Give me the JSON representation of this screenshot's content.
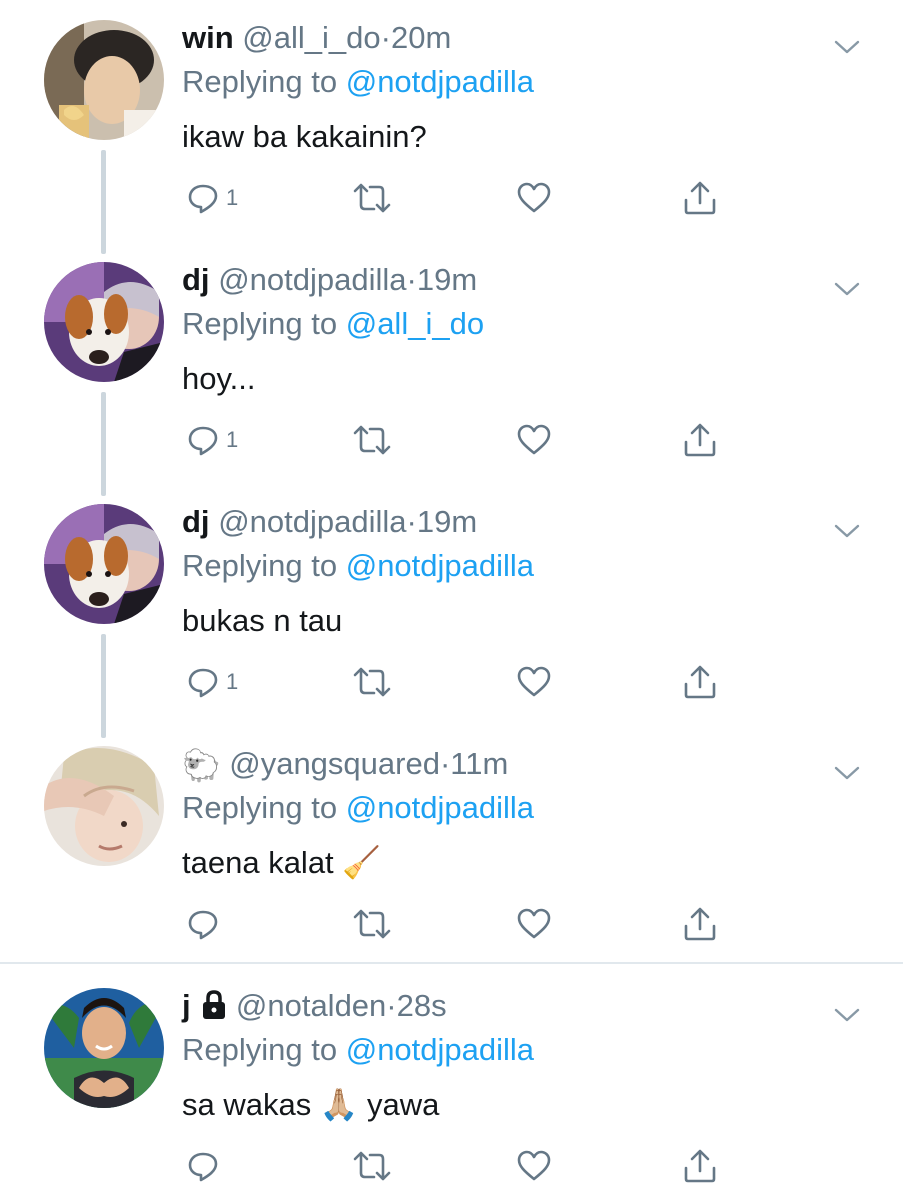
{
  "colors": {
    "name": "#14171a",
    "secondary": "#657786",
    "mention": "#1da1f2",
    "thread_line": "#ccd6dd",
    "divider": "#e1e8ed"
  },
  "tweets": [
    {
      "name": "win",
      "handle": "@all_i_do",
      "dot": "·",
      "time": "20m",
      "replying_prefix": "Replying to ",
      "replying_to": "@notdjpadilla",
      "text": "ikaw ba kakainin?",
      "reply_count": "1",
      "avatar_icon": "avatar-photo-win"
    },
    {
      "name": "dj",
      "handle": "@notdjpadilla",
      "dot": "·",
      "time": "19m",
      "replying_prefix": "Replying to ",
      "replying_to": "@all_i_do",
      "text": "hoy...",
      "reply_count": "1",
      "avatar_icon": "avatar-photo-dog"
    },
    {
      "name": "dj",
      "handle": "@notdjpadilla",
      "dot": "·",
      "time": "19m",
      "replying_prefix": "Replying to ",
      "replying_to": "@notdjpadilla",
      "text": "bukas n tau",
      "reply_count": "1",
      "avatar_icon": "avatar-photo-dog"
    },
    {
      "name": "🐑",
      "handle": "@yangsquared",
      "dot": "·",
      "time": "11m",
      "replying_prefix": "Replying to ",
      "replying_to": "@notdjpadilla",
      "text": "taena kalat 🧹",
      "reply_count": "",
      "avatar_icon": "avatar-photo-blonde"
    },
    {
      "name": "j",
      "name_badge_icon": "lock-icon",
      "handle": "@notalden",
      "dot": "·",
      "time": "28s",
      "replying_prefix": "Replying to ",
      "replying_to": "@notdjpadilla",
      "text": "sa wakas 🙏🏼 yawa",
      "reply_count": "",
      "avatar_icon": "avatar-photo-heart"
    }
  ]
}
